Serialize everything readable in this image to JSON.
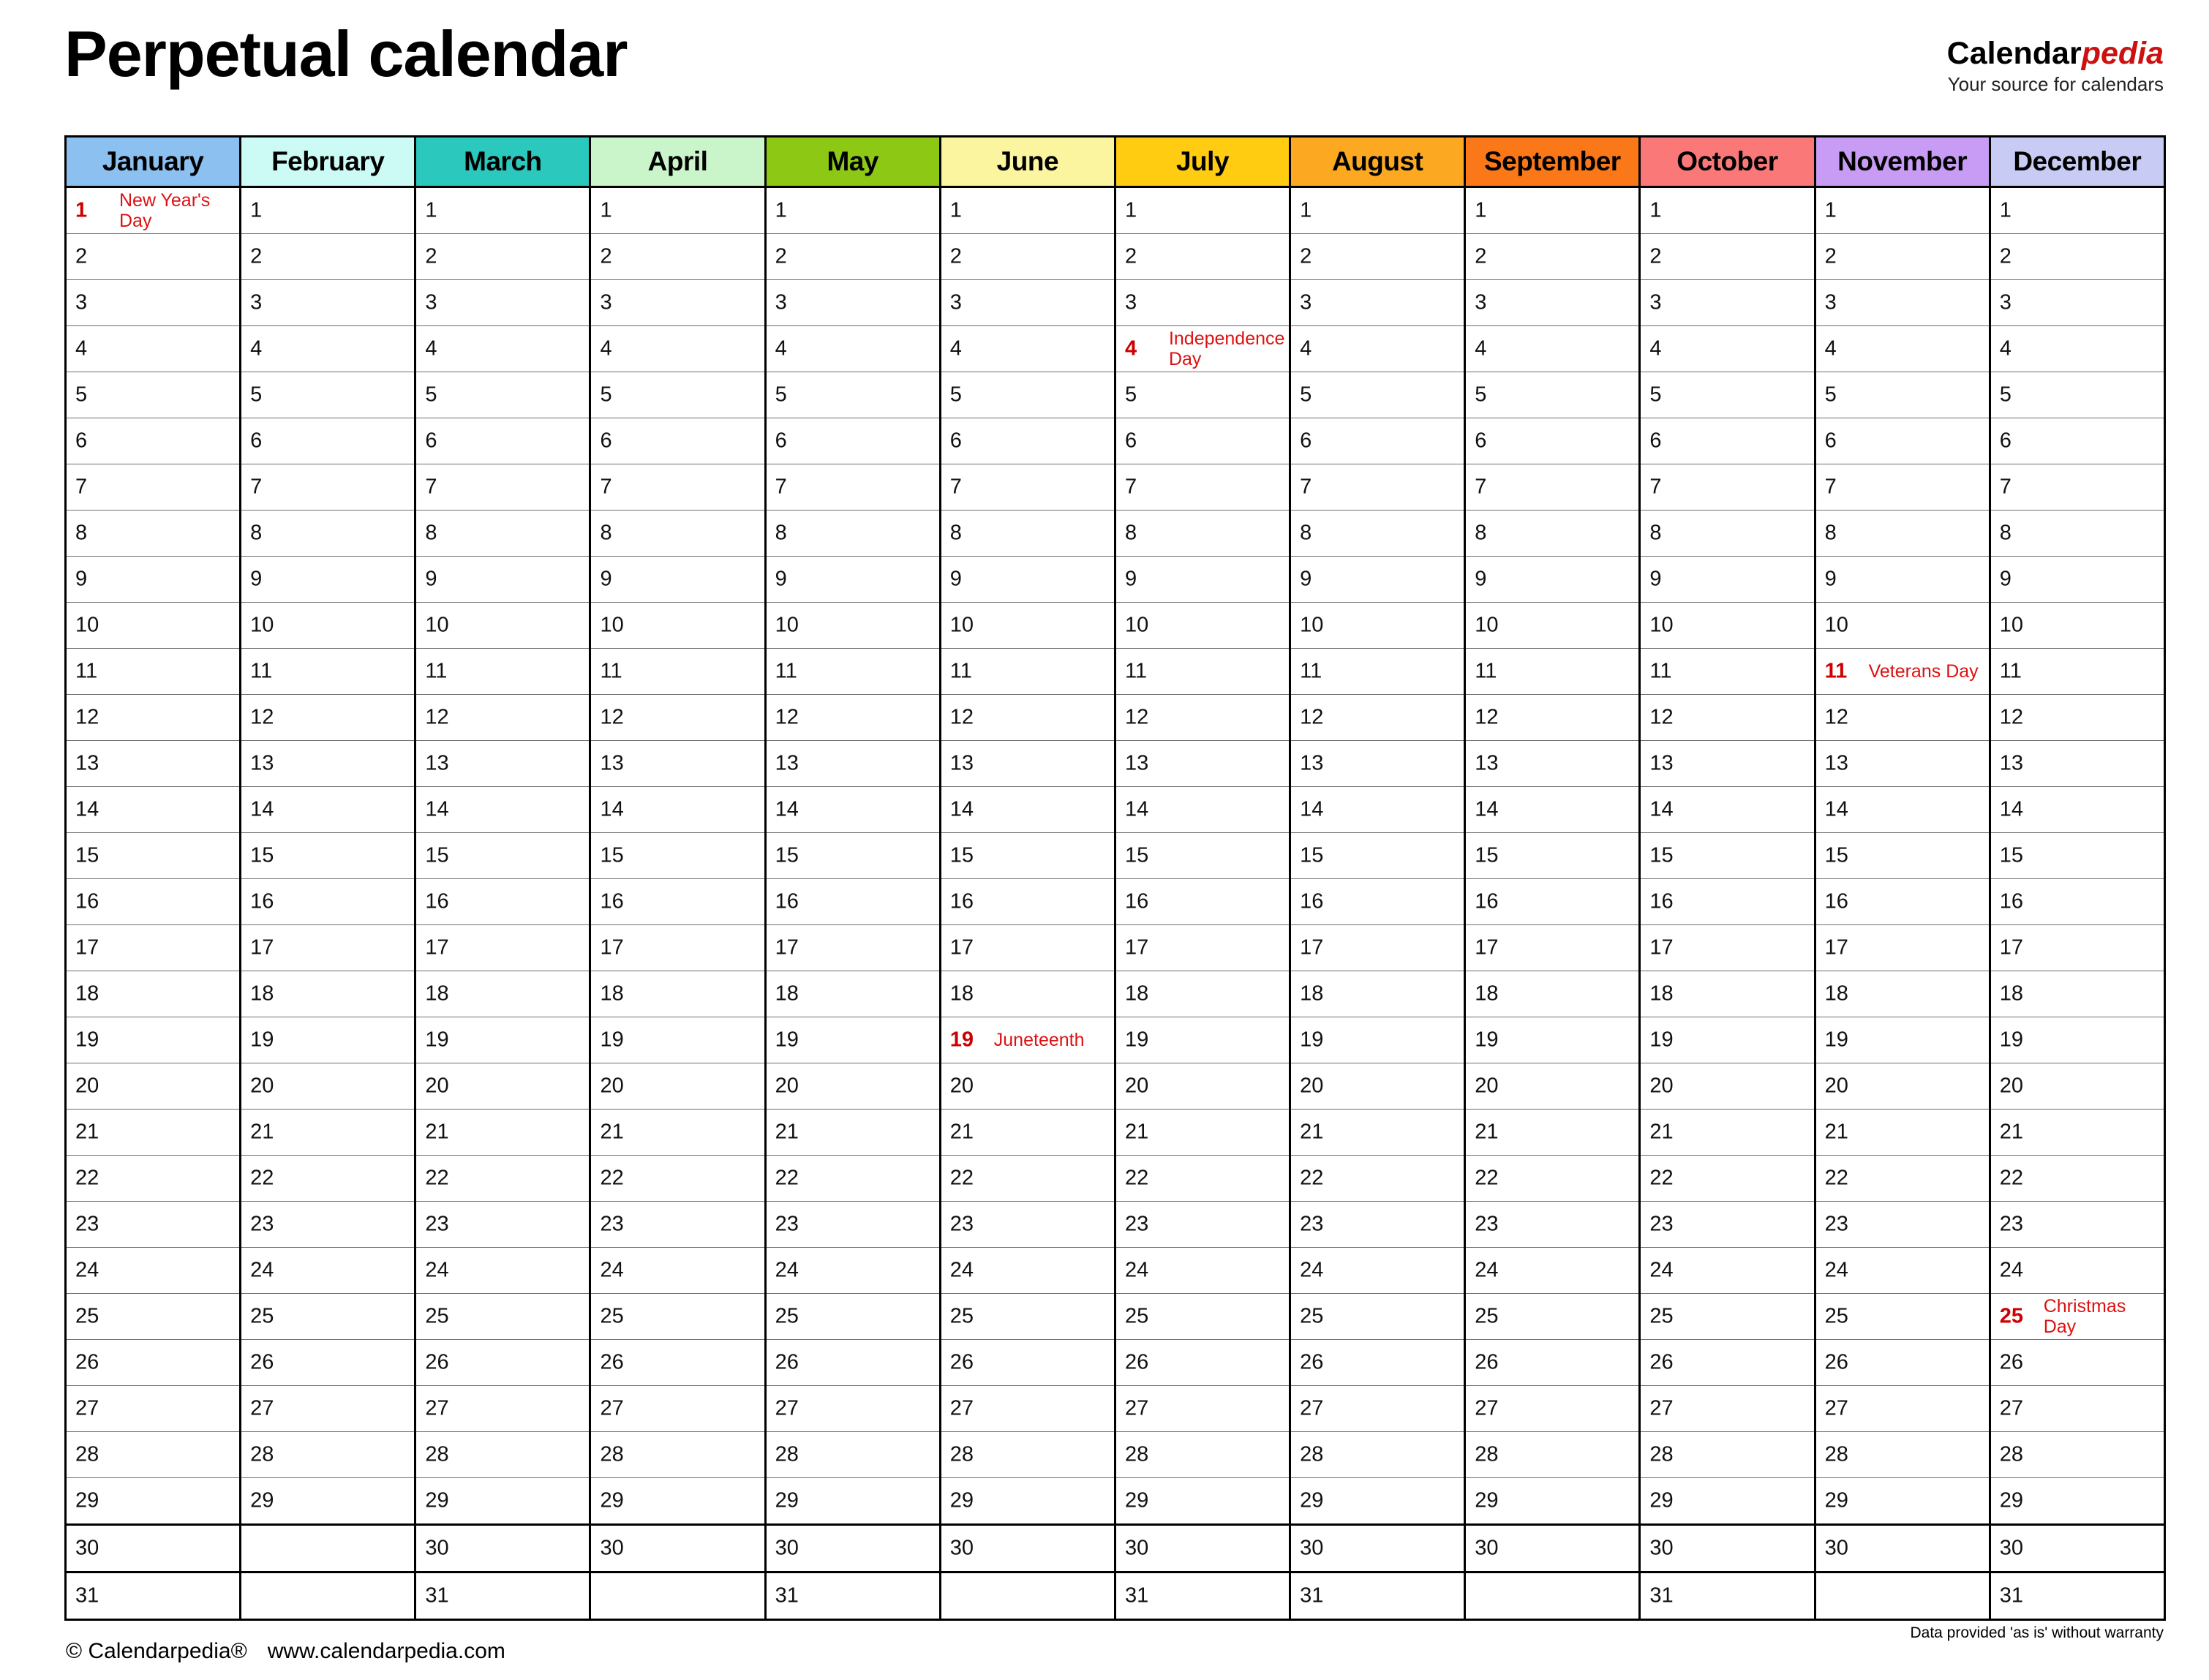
{
  "header": {
    "title": "Perpetual calendar",
    "brand_name_black": "Calendar",
    "brand_name_red": "pedia",
    "brand_tagline": "Your source for calendars"
  },
  "footer": {
    "copyright": "© Calendarpedia®",
    "website": "www.calendarpedia.com",
    "disclaimer": "Data provided 'as is' without warranty"
  },
  "table": {
    "months": [
      {
        "name": "January",
        "color": "#8cc0f0",
        "days": 31
      },
      {
        "name": "February",
        "color": "#ccfaf5",
        "days": 29
      },
      {
        "name": "March",
        "color": "#2bc8bd",
        "days": 31
      },
      {
        "name": "April",
        "color": "#caf5ca",
        "days": 30
      },
      {
        "name": "May",
        "color": "#8cc814",
        "days": 31
      },
      {
        "name": "June",
        "color": "#fbf5a0",
        "days": 30
      },
      {
        "name": "July",
        "color": "#ffcc11",
        "days": 31
      },
      {
        "name": "August",
        "color": "#fca921",
        "days": 31
      },
      {
        "name": "September",
        "color": "#fb7818",
        "days": 30
      },
      {
        "name": "October",
        "color": "#fb7878",
        "days": 31
      },
      {
        "name": "November",
        "color": "#c89cf5",
        "days": 30
      },
      {
        "name": "December",
        "color": "#c8ccf5",
        "days": 31
      }
    ],
    "day_rows": [
      1,
      2,
      3,
      4,
      5,
      6,
      7,
      8,
      9,
      10,
      11,
      12,
      13,
      14,
      15,
      16,
      17,
      18,
      19,
      20,
      21,
      22,
      23,
      24,
      25,
      26,
      27,
      28,
      29,
      30,
      31
    ],
    "holidays": [
      {
        "month": 1,
        "day": 1,
        "name": "New Year's Day"
      },
      {
        "month": 7,
        "day": 4,
        "name": "Independence Day"
      },
      {
        "month": 6,
        "day": 19,
        "name": "Juneteenth"
      },
      {
        "month": 11,
        "day": 11,
        "name": "Veterans Day"
      },
      {
        "month": 12,
        "day": 25,
        "name": "Christmas Day"
      }
    ],
    "colors": {
      "holiday_background": "#fcd3d3",
      "holiday_text": "#dd1111",
      "blank_cell_background": "#e6e6e6",
      "grid_line": "#000000"
    }
  }
}
